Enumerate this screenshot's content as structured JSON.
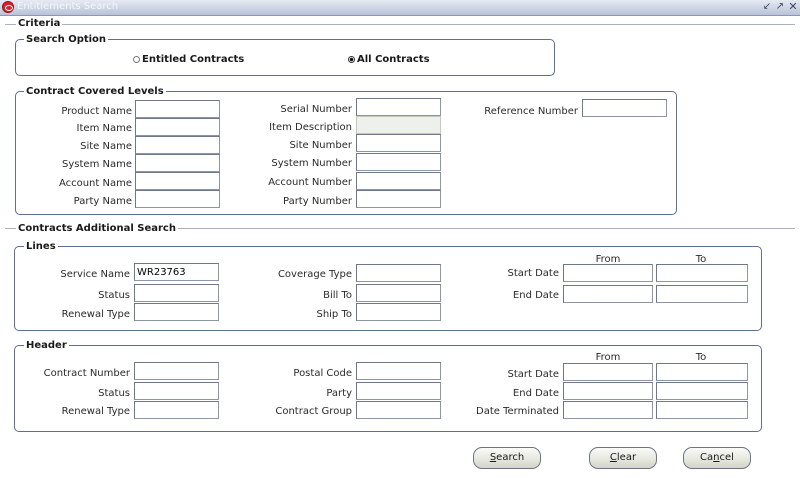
{
  "window": {
    "title": "Entitlements Search",
    "controls": [
      "minimize",
      "maximize",
      "close"
    ]
  },
  "criteria": {
    "label": "Criteria",
    "search_option": {
      "label": "Search Option",
      "options": [
        {
          "label": "Entitled Contracts",
          "selected": false
        },
        {
          "label": "All Contracts",
          "selected": true
        }
      ]
    },
    "covered_levels": {
      "label": "Contract Covered Levels",
      "fields": {
        "product_name": {
          "label": "Product Name",
          "value": ""
        },
        "item_name": {
          "label": "Item Name",
          "value": ""
        },
        "site_name": {
          "label": "Site Name",
          "value": ""
        },
        "system_name": {
          "label": "System Name",
          "value": ""
        },
        "account_name": {
          "label": "Account Name",
          "value": ""
        },
        "party_name": {
          "label": "Party Name",
          "value": ""
        },
        "serial_number": {
          "label": "Serial Number",
          "value": ""
        },
        "item_description": {
          "label": "Item Description",
          "value": ""
        },
        "site_number": {
          "label": "Site Number",
          "value": ""
        },
        "system_number": {
          "label": "System Number",
          "value": ""
        },
        "account_number": {
          "label": "Account Number",
          "value": ""
        },
        "party_number": {
          "label": "Party Number",
          "value": ""
        },
        "reference_number": {
          "label": "Reference Number",
          "value": ""
        }
      }
    }
  },
  "additional": {
    "label": "Contracts Additional Search",
    "lines": {
      "label": "Lines",
      "from_label": "From",
      "to_label": "To",
      "fields": {
        "service_name": {
          "label": "Service Name",
          "value": "WR23763"
        },
        "status": {
          "label": "Status",
          "value": ""
        },
        "renewal_type": {
          "label": "Renewal Type",
          "value": ""
        },
        "coverage_type": {
          "label": "Coverage Type",
          "value": ""
        },
        "bill_to": {
          "label": "Bill To",
          "value": ""
        },
        "ship_to": {
          "label": "Ship To",
          "value": ""
        },
        "start_date": {
          "label": "Start Date",
          "from": "",
          "to": ""
        },
        "end_date": {
          "label": "End Date",
          "from": "",
          "to": ""
        }
      }
    },
    "header": {
      "label": "Header",
      "from_label": "From",
      "to_label": "To",
      "fields": {
        "contract_number": {
          "label": "Contract Number",
          "value": ""
        },
        "status": {
          "label": "Status",
          "value": ""
        },
        "renewal_type": {
          "label": "Renewal Type",
          "value": ""
        },
        "postal_code": {
          "label": "Postal Code",
          "value": ""
        },
        "party": {
          "label": "Party",
          "value": ""
        },
        "contract_group": {
          "label": "Contract Group",
          "value": ""
        },
        "start_date": {
          "label": "Start Date",
          "from": "",
          "to": ""
        },
        "end_date": {
          "label": "End Date",
          "from": "",
          "to": ""
        },
        "date_terminated": {
          "label": "Date Terminated",
          "from": "",
          "to": ""
        }
      }
    }
  },
  "buttons": {
    "search": {
      "mnemonic": "S",
      "rest": "earch"
    },
    "clear": {
      "mnemonic": "C",
      "rest": "lear"
    },
    "cancel": {
      "pre": "Ca",
      "mnemonic": "n",
      "rest": "cel"
    }
  }
}
